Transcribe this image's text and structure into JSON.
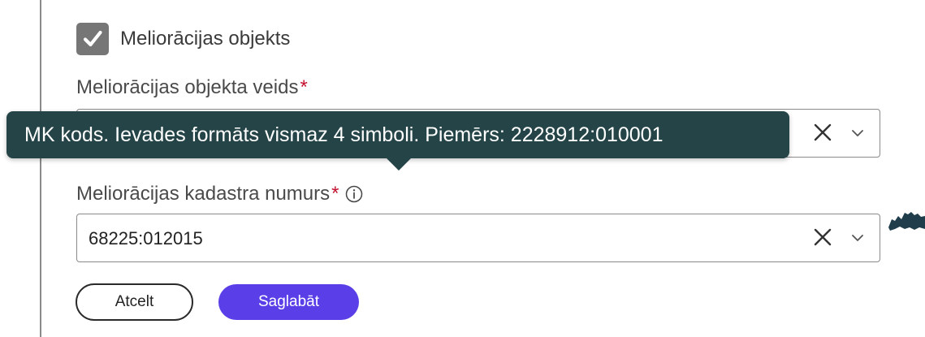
{
  "form": {
    "checkbox": {
      "label": "Meliorācijas objekts",
      "checked": true
    },
    "object_type": {
      "label": "Meliorācijas objekta veids",
      "required_marker": "*",
      "value": ""
    },
    "cadastre": {
      "label": "Meliorācijas kadastra numurs",
      "required_marker": "*",
      "value": "68225:012015"
    },
    "tooltip": {
      "text": "MK kods. Ievades formāts vismaz 4 simboli. Piemērs: 2228912:010001"
    },
    "buttons": {
      "cancel": "Atcelt",
      "save": "Saglabāt"
    }
  },
  "colors": {
    "tooltip_bg": "#244447",
    "primary": "#5a3ee8",
    "required": "#c4122f",
    "checkbox": "#767676",
    "map_shape": "#1f3d4a"
  },
  "icons": [
    "checkmark-icon",
    "clear-icon",
    "chevron-down-icon",
    "info-icon"
  ]
}
